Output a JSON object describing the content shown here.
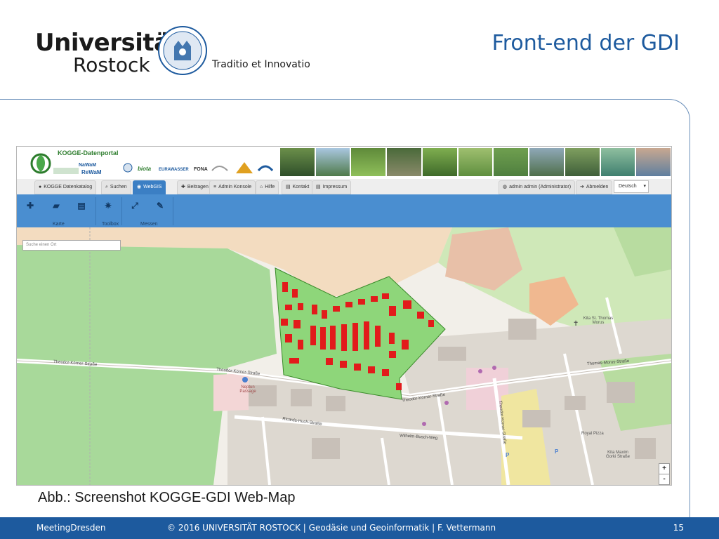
{
  "header": {
    "university_line1": "Universität",
    "university_line2": "Rostock",
    "motto": "Traditio et Innovatio",
    "slide_title": "Front-end der GDI"
  },
  "screenshot": {
    "portal_title": "KOGGE-Datenportal",
    "nav": {
      "tabs": [
        {
          "label": "KOGGE Datenkatalog",
          "icon": "logo-icon",
          "active": false
        },
        {
          "label": "Suchen",
          "icon": "search-icon",
          "active": false
        },
        {
          "label": "WebGIS",
          "icon": "globe-icon",
          "active": true
        },
        {
          "label": "Beitragen",
          "icon": "plus-icon",
          "active": false
        },
        {
          "label": "Admin Konsole",
          "icon": "list-icon",
          "active": false
        },
        {
          "label": "Hilfe",
          "icon": "help-icon",
          "active": false
        },
        {
          "label": "Kontakt",
          "icon": "contact-icon",
          "active": false
        },
        {
          "label": "Impressum",
          "icon": "info-icon",
          "active": false
        }
      ],
      "user_label": "admin admin (Administrator)",
      "logout_label": "Abmelden",
      "language_value": "Deutsch"
    },
    "toolbar": {
      "groups": [
        "Karte",
        "Toolbox",
        "Messen"
      ]
    },
    "map": {
      "search_placeholder": "Suche einen Ort",
      "zoom_in": "+",
      "zoom_out": "-",
      "street_labels": [
        "Theodor-Körner-Straße",
        "Theodor-Körner-Straße",
        "Theodor-Körner-Straße",
        "Ricarda-Huch-Straße",
        "Wilhelm-Busch-Weg",
        "Thomas-Morus-Straße",
        "Theodor-Körner-Straße"
      ],
      "place_labels": [
        "Neptun Passage",
        "Kita St. Thomas Morus",
        "Royal Pizza",
        "Kita Maxim Gorki Straße"
      ]
    },
    "accent": "#4a8ed0",
    "polygon_color": "#8ed67a",
    "building_color": "#e21b1b"
  },
  "caption": "Abb.: Screenshot KOGGE-GDI Web-Map",
  "footer": {
    "left": "MeetingDresden",
    "center": "©  2016  UNIVERSITÄT ROSTOCK  |  Geodäsie und Geoinformatik | F. Vettermann",
    "page_number": "15"
  },
  "theme": {
    "primary_blue": "#1d5a9e"
  }
}
